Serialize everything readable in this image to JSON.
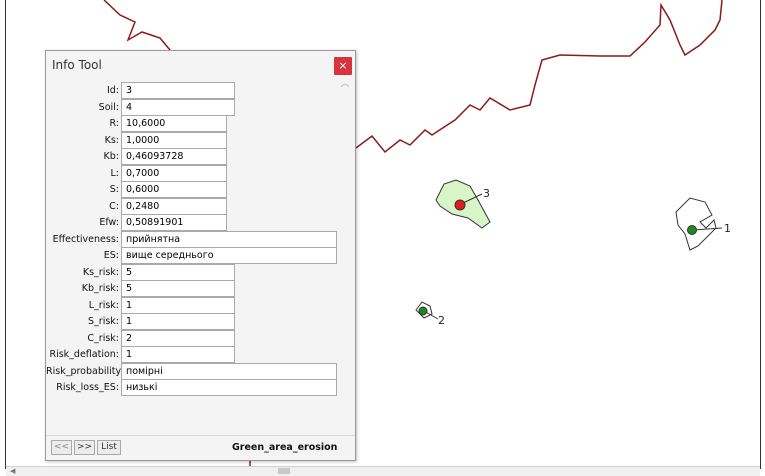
{
  "info_tool": {
    "title": "Info Tool",
    "close_icon": "×",
    "fields": [
      {
        "label": "Id:",
        "value": "3"
      },
      {
        "label": "Soil:",
        "value": "4"
      },
      {
        "label": "R:",
        "value": "10,6000"
      },
      {
        "label": "Ks:",
        "value": "1,0000"
      },
      {
        "label": "Kb:",
        "value": "0,46093728"
      },
      {
        "label": "L:",
        "value": "0,7000"
      },
      {
        "label": "S:",
        "value": "0,6000"
      },
      {
        "label": "C:",
        "value": "0,2480"
      },
      {
        "label": "Efw:",
        "value": "0,50891901"
      },
      {
        "label": "Effectiveness:",
        "value": "прийнятна"
      },
      {
        "label": "ES:",
        "value": "вище середнього"
      },
      {
        "label": "Ks_risk:",
        "value": "5"
      },
      {
        "label": "Kb_risk:",
        "value": "5"
      },
      {
        "label": "L_risk:",
        "value": "1"
      },
      {
        "label": "S_risk:",
        "value": "1"
      },
      {
        "label": "C_risk:",
        "value": "2"
      },
      {
        "label": "Risk_deflation:",
        "value": "1"
      },
      {
        "label": "Risk_probability:",
        "value": "помірні"
      },
      {
        "label": "Risk_loss_ES:",
        "value": "низькі"
      }
    ],
    "nav": {
      "prev": "<<",
      "next": ">>",
      "list": "List"
    },
    "layer_name": "Green_area_erosion"
  },
  "map": {
    "feature_labels": [
      "1",
      "2",
      "3"
    ],
    "selected_color": "#e21b1b",
    "point_color": "#1c8a1c",
    "boundary_color": "#8b1a1a",
    "selected_fill": "#d8f5c8"
  }
}
